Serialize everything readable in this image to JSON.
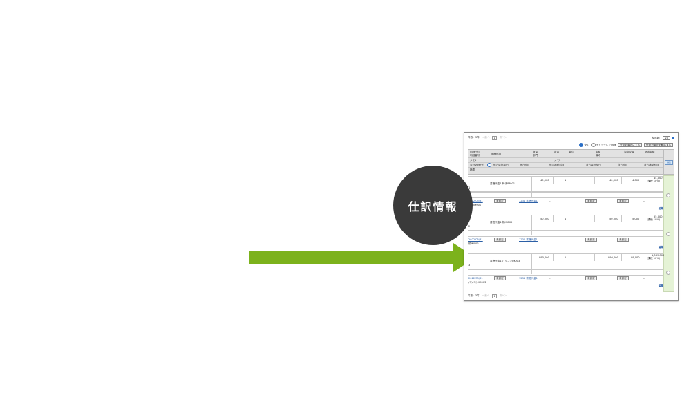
{
  "callout": {
    "label": "仕訳情報"
  },
  "pager": {
    "count": "件数：3件",
    "prev": "＜前へ",
    "page": "1",
    "next": "次へ＞"
  },
  "display": {
    "label": "表示数：",
    "value": "20"
  },
  "toolbar": {
    "radio_all": "全て",
    "radio_checked": "チェックした明細",
    "btn_exclude": "仕訳対象外にする",
    "btn_release": "仕訳対象外を解除する"
  },
  "header": {
    "row1": [
      "明細日付",
      "明細科目",
      "数量",
      "数量",
      "単位",
      "金額",
      "源泉税額",
      "請求金額"
    ],
    "row2": [
      "明細番号",
      "部門",
      "備考"
    ],
    "row3": [
      "メモ1",
      "メモ2"
    ],
    "row4": [
      "会計処理日付",
      "借方負担部門",
      "借方科目",
      "借方補助科目",
      "貸方負担部門",
      "貸方科目",
      "貸方補助科目"
    ],
    "row5": [
      "摘要"
    ],
    "edit_all": "編集"
  },
  "entries": [
    {
      "name": "書籍代金1 椅子IM001",
      "unit_price": "40,000",
      "qty": "1",
      "amount": "40,000",
      "tax": "4,000",
      "total": "44,000",
      "tax_note": "(課税 10%)",
      "no": "1",
      "date": "2022/05/31",
      "status": "未設定",
      "account": "1234 書籍代金1",
      "dash": "--",
      "memo": "椅子IM001",
      "edit": "編集"
    },
    {
      "name": "書籍代金1 机IM002",
      "unit_price": "50,000",
      "qty": "1",
      "amount": "50,000",
      "tax": "5,000",
      "total": "55,000",
      "tax_note": "(課税 10%)",
      "no": "2",
      "date": "2022/05/31",
      "status": "未設定",
      "account": "1234 書籍代金1",
      "dash": "--",
      "memo": "机IM002",
      "edit": "編集"
    },
    {
      "name": "書籍代金1 パソコンIM003",
      "unit_price": "990,000",
      "qty": "1",
      "amount": "990,000",
      "tax": "99,000",
      "total": "1,089,000",
      "tax_note": "(課税 10%)",
      "no": "3",
      "date": "2022/05/31",
      "status": "未設定",
      "account": "1234 書籍代金1",
      "dash": "--",
      "memo": "パソコンIM003",
      "edit": "編集"
    }
  ],
  "colors": {
    "arrow": "#7cb21c",
    "circle": "#3a3a3a",
    "link": "#2b5fa6",
    "side": "#e5f3d6"
  }
}
